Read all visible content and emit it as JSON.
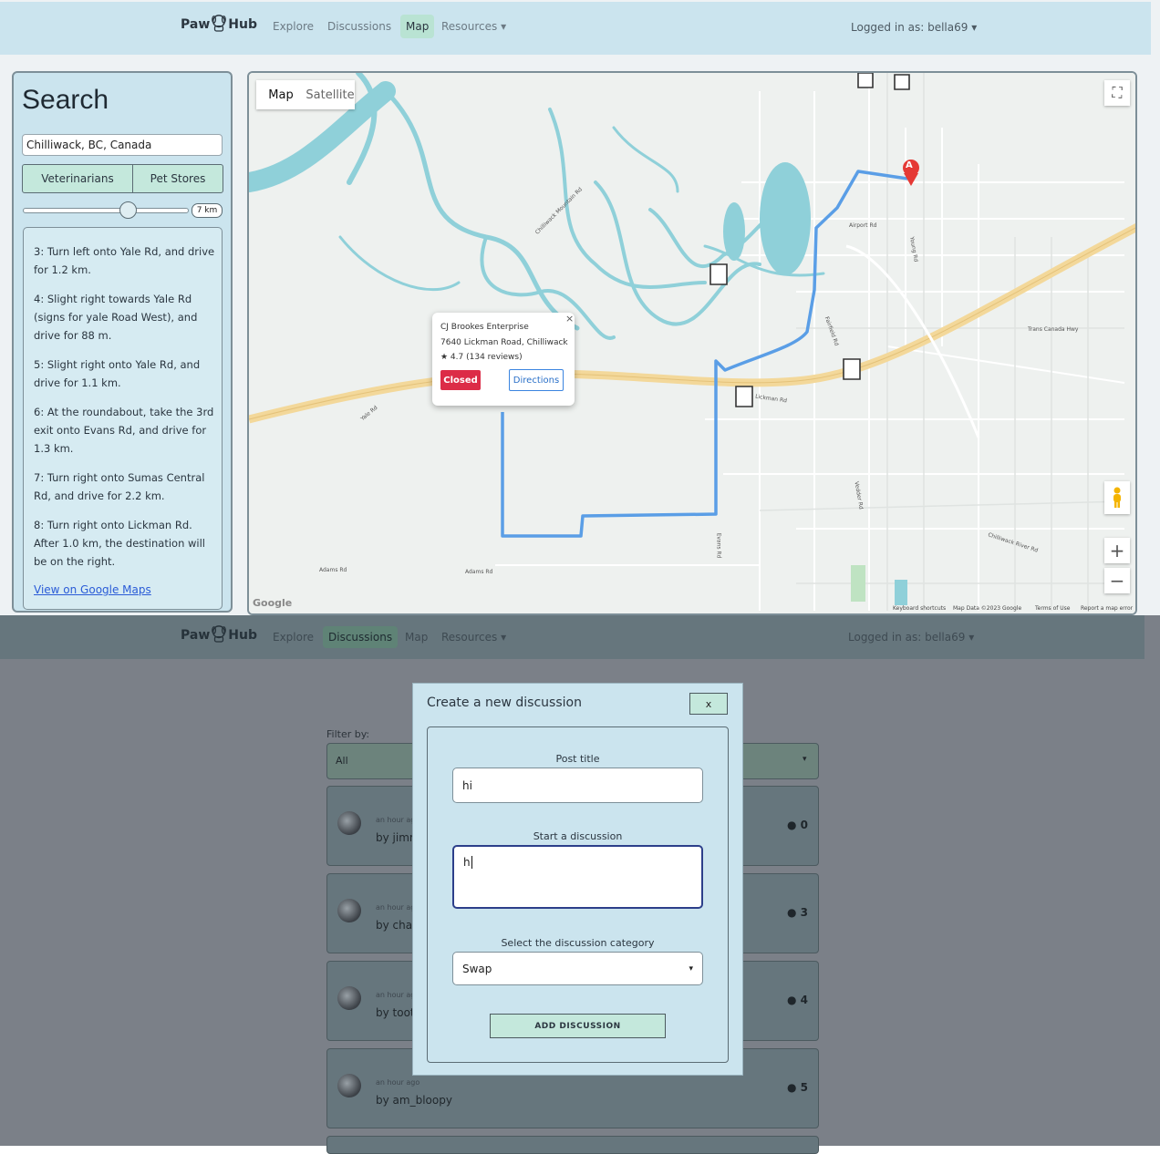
{
  "top_app": {
    "brand_left": "Paw",
    "brand_right": "Hub",
    "nav": {
      "explore": "Explore",
      "discussions": "Discussions",
      "map": "Map",
      "resources": "Resources ▾"
    },
    "user_menu": "Logged in as: bella69 ▾"
  },
  "sidebar": {
    "title": "Search",
    "location_value": "Chilliwack, BC, Canada",
    "segments": [
      "Veterinarians",
      "Pet Stores"
    ],
    "radius_label": "7 km",
    "radius_level": 0.6,
    "steps": [
      "3: Turn left onto Yale Rd, and drive for 1.2 km.",
      "4: Slight right towards Yale Rd (signs for yale Road West), and drive for 88 m.",
      "5: Slight right onto Yale Rd, and drive for 1.1 km.",
      "6: At the roundabout, take the 3rd exit onto Evans Rd, and drive for 1.3 km.",
      "7: Turn right onto Sumas Central Rd, and drive for 2.2 km.",
      "8: Turn right onto Lickman Rd. After 1.0 km, the destination will be on the right."
    ],
    "gmaps_link": "View on Google Maps"
  },
  "map": {
    "type_map": "Map",
    "type_satellite": "Satellite",
    "infowindow": {
      "name": "CJ Brookes Enterprise",
      "address": "7640 Lickman Road, Chilliwack",
      "rating": "★ 4.7 (134 reviews)",
      "status": "Closed",
      "directions": "Directions",
      "close": "×"
    },
    "marker_label": "A",
    "zoom_in": "+",
    "zoom_out": "−",
    "fullscreen": "⛶",
    "google": "Google",
    "attribution": [
      "Keyboard shortcuts",
      "Map Data ©2023 Google",
      "Terms of Use",
      "Report a map error"
    ],
    "roads": {
      "airport": "Airport Rd",
      "yale": "Yale Rd",
      "evans": "Evans Rd",
      "adams1": "Adams Rd",
      "adams2": "Adams Rd",
      "trans": "Trans Canada Hwy",
      "chilliwack_river": "Chilliwack River Rd",
      "lickman": "Lickman Rd",
      "chilliwack_mtn": "Chilliwack Mountain Rd",
      "young": "Young Rd",
      "fairfield": "Fairfield Rd",
      "vedder": "Vedder Rd"
    },
    "colors": {
      "route": "#5a9ee6",
      "water": "#8fd0d9",
      "highway": "#f3d89a",
      "marker": "#e53935"
    }
  },
  "bottom_app": {
    "brand_left": "Paw",
    "brand_right": "Hub",
    "nav": {
      "explore": "Explore",
      "discussions": "Discussions",
      "map": "Map",
      "resources": "Resources ▾"
    },
    "user_menu": "Logged in as: bella69 ▾",
    "filter_label": "Filter by:",
    "filter_value": "All",
    "posts": [
      {
        "time": "an hour ago",
        "author": "by jimmy",
        "comments": "0"
      },
      {
        "time": "an hour ago",
        "author": "by chai",
        "comments": "3"
      },
      {
        "time": "an hour ago",
        "author": "by toot",
        "comments": "4"
      },
      {
        "time": "an hour ago",
        "author": "by am_bloopy",
        "comments": "5"
      }
    ]
  },
  "modal": {
    "title": "Create a new discussion",
    "close": "x",
    "post_title_label": "Post title",
    "post_title_value": "hi",
    "body_label": "Start a discussion",
    "body_value": "h",
    "category_label": "Select the discussion category",
    "category_value": "Swap",
    "submit": "ADD DISCUSSION"
  }
}
